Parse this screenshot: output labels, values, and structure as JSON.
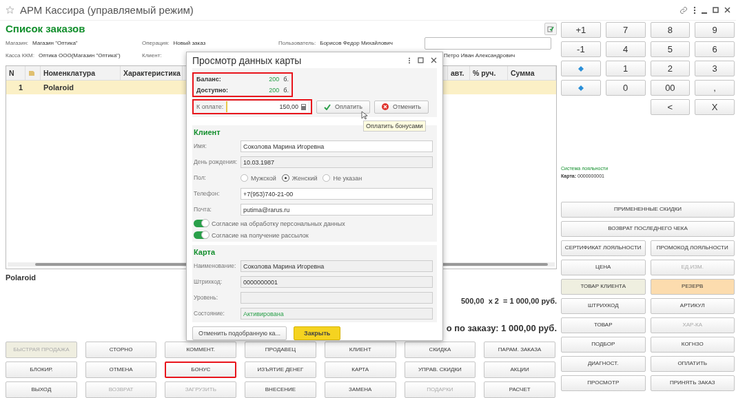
{
  "window": {
    "title": "АРМ Кассира (управляемый режим)"
  },
  "page_title": "Список заказов",
  "info": [
    {
      "label": "Магазин:",
      "value": "Магазин \"Оптика\""
    },
    {
      "label": "Операция:",
      "value": "Новый заказ"
    },
    {
      "label": "Пользователь:",
      "value": "Борисов Федор Михайлович"
    },
    {
      "label": "Касса ККМ:",
      "value": "Оптика ООО(Магазин \"Оптика\")"
    },
    {
      "label": "Клиент:"
    },
    {
      "value": "Петро Иван Александрович"
    }
  ],
  "table": {
    "columns": [
      {
        "kind": "text",
        "label": "N"
      },
      {
        "kind": "icon"
      },
      {
        "kind": "text",
        "label": "Номенклатура"
      },
      {
        "kind": "text",
        "label": "Характеристика"
      },
      {
        "kind": "blank"
      },
      {
        "kind": "text",
        "label": "авт."
      },
      {
        "kind": "text",
        "label": "% руч."
      },
      {
        "kind": "text",
        "label": "Сумма"
      }
    ],
    "rows": [
      {
        "selected": true,
        "n": "1",
        "name": "Polaroid"
      }
    ]
  },
  "item_name": "Polaroid",
  "line_total": "500,00  x 2  = 1 000,00 руб.",
  "order_total": "о по заказу: 1 000,00 руб.",
  "actions": [
    [
      {
        "label": "БЫСТРАЯ ПРОДАЖА",
        "disabled": true,
        "color": "#efeee0"
      },
      {
        "label": "СТОРНО",
        "disabled": false
      },
      {
        "label": "КОММЕНТ.",
        "disabled": false
      },
      {
        "label": "ПРОДАВЕЦ",
        "disabled": false
      },
      {
        "label": "КЛИЕНТ",
        "disabled": false
      },
      {
        "label": "СКИДКА",
        "disabled": false
      },
      {
        "label": "ПАРАМ. ЗАКАЗА",
        "disabled": false
      }
    ],
    [
      {
        "label": "БЛОКИР.",
        "disabled": false
      },
      {
        "label": "ОТМЕНА",
        "disabled": false
      },
      {
        "label": "БОНУС",
        "disabled": false,
        "highlighted": true
      },
      {
        "label": "ИЗЪЯТИЕ ДЕНЕГ",
        "disabled": false
      },
      {
        "label": "КАРТА",
        "disabled": false
      },
      {
        "label": "УПРАВ. СКИДКИ",
        "disabled": false
      },
      {
        "label": "АКЦИИ",
        "disabled": false
      }
    ],
    [
      {
        "label": "ВЫХОД",
        "disabled": false
      },
      {
        "label": "ВОЗВРАТ",
        "disabled": true
      },
      {
        "label": "ЗАГРУЗИТЬ",
        "disabled": true
      },
      {
        "label": "ВНЕСЕНИЕ",
        "disabled": false
      },
      {
        "label": "ЗАМЕНА",
        "disabled": false
      },
      {
        "label": "ПОДАРКИ",
        "disabled": true
      },
      {
        "label": "РАСЧЕТ",
        "disabled": false
      }
    ]
  ],
  "keypad": [
    {
      "kind": "text",
      "label": "+1"
    },
    {
      "kind": "text",
      "label": "7"
    },
    {
      "kind": "text",
      "label": "8"
    },
    {
      "kind": "text",
      "label": "9"
    },
    {
      "kind": "text",
      "label": "-1"
    },
    {
      "kind": "text",
      "label": "4"
    },
    {
      "kind": "text",
      "label": "5"
    },
    {
      "kind": "text",
      "label": "6"
    },
    {
      "kind": "diamond"
    },
    {
      "kind": "text",
      "label": "1"
    },
    {
      "kind": "text",
      "label": "2"
    },
    {
      "kind": "text",
      "label": "3"
    },
    {
      "kind": "diamond"
    },
    {
      "kind": "text",
      "label": "0"
    },
    {
      "kind": "text",
      "label": "00"
    },
    {
      "kind": "text",
      "label": ","
    },
    {
      "kind": "blank"
    },
    {
      "kind": "blank"
    },
    {
      "kind": "text",
      "label": "<"
    },
    {
      "kind": "text",
      "label": "X"
    }
  ],
  "loyalty": {
    "title": "Система лояльности",
    "card_label": "Карта:",
    "card_value": "0000000001"
  },
  "side_buttons": [
    [
      {
        "label": "ПРИМЕНЕННЫЕ СКИДКИ",
        "disabled": false
      }
    ],
    [
      {
        "label": "ВОЗВРАТ ПОСЛЕДНЕГО ЧЕКА",
        "disabled": false
      }
    ],
    [
      {
        "label": "СЕРТИФИКАТ ЛОЯЛЬНОСТИ",
        "disabled": false
      },
      {
        "label": "ПРОМОКОД ЛОЯЛЬНОСТИ",
        "disabled": false
      }
    ],
    [
      {
        "label": "ЦЕНА",
        "disabled": false
      },
      {
        "label": "ЕД.ИЗМ.",
        "disabled": true
      }
    ],
    [
      {
        "label": "ТОВАР КЛИЕНТА",
        "disabled": false,
        "color": "#efefe0"
      },
      {
        "label": "РЕЗЕРВ",
        "disabled": false,
        "color": "#fcdcae"
      }
    ],
    [
      {
        "label": "ШТРИХКОД",
        "disabled": false
      },
      {
        "label": "АРТИКУЛ",
        "disabled": false
      }
    ],
    [
      {
        "label": "ТОВАР",
        "disabled": false
      },
      {
        "label": "ХАР-КА",
        "disabled": true
      }
    ],
    [
      {
        "label": "ПОДБОР",
        "disabled": false
      },
      {
        "label": "КОГНЗО",
        "disabled": false
      }
    ],
    [
      {
        "label": "ДИАГНОСТ.",
        "disabled": false
      },
      {
        "label": "ОПЛАТИТЬ",
        "disabled": false
      }
    ],
    [
      {
        "label": "ПРОСМОТР",
        "disabled": false
      },
      {
        "label": "ПРИНЯТЬ ЗАКАЗ",
        "disabled": false
      }
    ]
  ],
  "dialog": {
    "title": "Просмотр данных карты",
    "balance": {
      "highlighted": true,
      "rows": [
        {
          "label": "Баланс:",
          "value": "200",
          "unit": "б."
        },
        {
          "label": "Доступно:",
          "value": "200",
          "unit": "б."
        }
      ]
    },
    "to_pay": {
      "highlighted": true,
      "label": "К оплате:",
      "value": "150,00"
    },
    "pay_button": "Оплатить",
    "cancel_button": "Отменить",
    "tooltip": "Оплатить бонусами",
    "client": {
      "title": "Клиент",
      "fields": [
        {
          "kind": "input",
          "label": "Имя:",
          "value": "Соколова Марина Игоревна"
        },
        {
          "kind": "readonly",
          "label": "День рождения:",
          "value": "10.03.1987"
        },
        {
          "kind": "radio",
          "label": "Пол:",
          "options": [
            {
              "label": "Мужской",
              "selected": false
            },
            {
              "label": "Женский",
              "selected": true
            },
            {
              "label": "Не указан",
              "selected": false
            }
          ]
        },
        {
          "kind": "input",
          "label": "Телефон:",
          "value": "+7(953)740-21-00"
        },
        {
          "kind": "input",
          "label": "Почта:",
          "value": "putima@rarus.ru"
        }
      ],
      "toggles": [
        {
          "label": "Согласие на обработку персональных данных",
          "on": true
        },
        {
          "label": "Согласие на получение рассылок",
          "on": true
        }
      ]
    },
    "card": {
      "title": "Карта",
      "fields": [
        {
          "kind": "readonly",
          "label": "Наименование:",
          "value": "Соколова Марина Игоревна"
        },
        {
          "kind": "readonly",
          "label": "Штрихкод:",
          "value": "0000000001"
        },
        {
          "kind": "readonly",
          "label": "Уровень:"
        },
        {
          "kind": "status",
          "label": "Состояние:",
          "value": "Активирована"
        }
      ]
    },
    "footer": [
      {
        "kind": "secondary",
        "label": "Отменить подобранную ка..."
      },
      {
        "kind": "primary",
        "label": "Закрыть"
      }
    ]
  }
}
